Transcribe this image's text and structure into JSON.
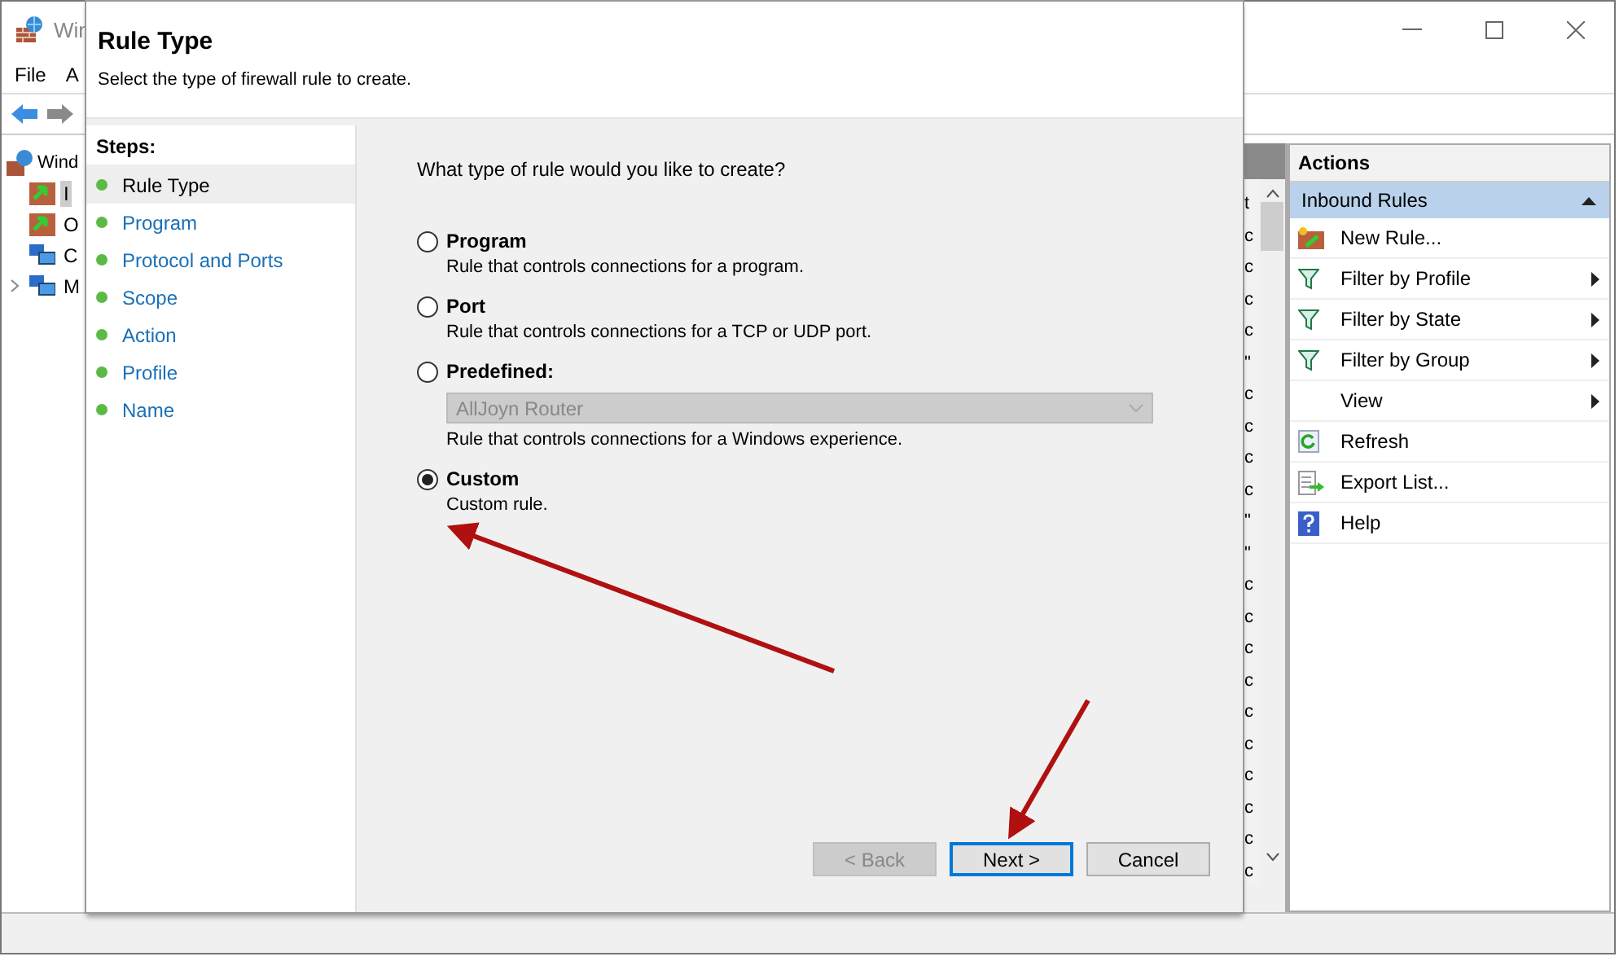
{
  "main_window": {
    "title": "Win",
    "menu": [
      "File",
      "A"
    ],
    "tree": [
      {
        "label": "Wind",
        "children": [
          {
            "label": "I",
            "kind": "rules",
            "selected": true,
            "has_children": false
          },
          {
            "label": "O",
            "kind": "rules",
            "selected": false,
            "has_children": false
          },
          {
            "label": "C",
            "kind": "computer",
            "selected": false,
            "has_children": false
          },
          {
            "label": "M",
            "kind": "computer",
            "selected": false,
            "has_children": true
          }
        ]
      }
    ],
    "list_fragments": [
      "t",
      "c",
      "c",
      "c",
      "c",
      "\"",
      "c",
      "c",
      "c",
      "c",
      "\"",
      "\"",
      "c",
      "c",
      "c",
      "c",
      "c",
      "c",
      "c",
      "c",
      "c",
      "c"
    ]
  },
  "actions": {
    "title": "Actions",
    "section": "Inbound Rules",
    "items": [
      {
        "label": "New Rule...",
        "kind": "new-rule",
        "submenu": false
      },
      {
        "label": "Filter by Profile",
        "kind": "filter",
        "submenu": true
      },
      {
        "label": "Filter by State",
        "kind": "filter",
        "submenu": true
      },
      {
        "label": "Filter by Group",
        "kind": "filter",
        "submenu": true
      },
      {
        "label": "View",
        "kind": "none",
        "submenu": true
      },
      {
        "label": "Refresh",
        "kind": "refresh",
        "submenu": false
      },
      {
        "label": "Export List...",
        "kind": "export",
        "submenu": false
      },
      {
        "label": "Help",
        "kind": "help",
        "submenu": false
      }
    ]
  },
  "dialog": {
    "title": "Rule Type",
    "subtitle": "Select the type of firewall rule to create.",
    "steps_title": "Steps:",
    "steps": [
      {
        "label": "Rule Type",
        "selected": true
      },
      {
        "label": "Program",
        "selected": false
      },
      {
        "label": "Protocol and Ports",
        "selected": false
      },
      {
        "label": "Scope",
        "selected": false
      },
      {
        "label": "Action",
        "selected": false
      },
      {
        "label": "Profile",
        "selected": false
      },
      {
        "label": "Name",
        "selected": false
      }
    ],
    "question": "What type of rule would you like to create?",
    "options": [
      {
        "label": "Program",
        "description": "Rule that controls connections for a program.",
        "selected": false
      },
      {
        "label": "Port",
        "description": "Rule that controls connections for a TCP or UDP port.",
        "selected": false
      },
      {
        "label": "Predefined:",
        "dropdown": "AllJoyn Router",
        "description": "Rule that controls connections for a Windows experience.",
        "selected": false
      },
      {
        "label": "Custom",
        "description": "Custom rule.",
        "selected": true
      }
    ],
    "buttons": [
      {
        "label": "< Back",
        "disabled": true,
        "default": false
      },
      {
        "label": "Next >",
        "disabled": false,
        "default": true
      },
      {
        "label": "Cancel",
        "disabled": false,
        "default": false
      }
    ]
  }
}
